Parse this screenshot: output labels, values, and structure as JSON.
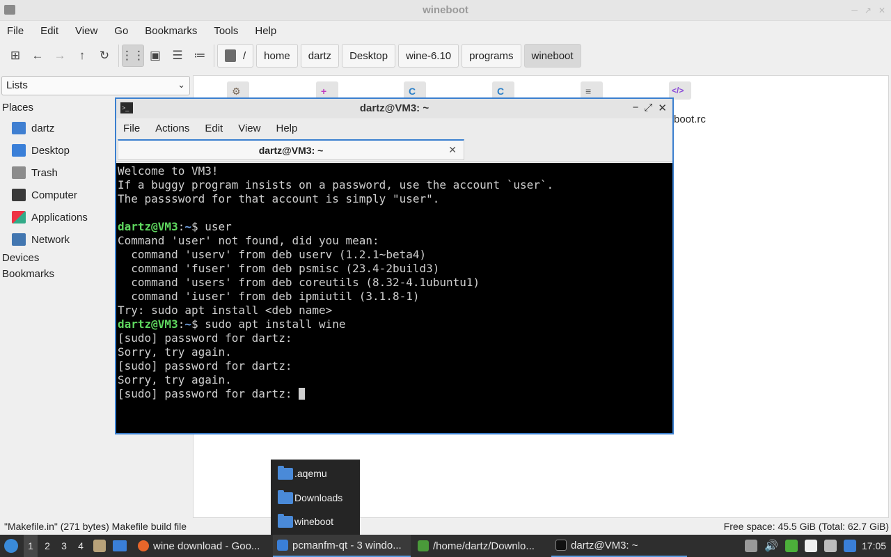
{
  "fm": {
    "title": "wineboot",
    "menu": [
      "File",
      "Edit",
      "View",
      "Go",
      "Bookmarks",
      "Tools",
      "Help"
    ],
    "toolbar_icons": [
      "new-tab-icon",
      "back-icon",
      "forward-icon",
      "up-icon",
      "reload-icon",
      "icon-view-icon",
      "thumbnail-view-icon",
      "compact-view-icon",
      "detailed-list-icon"
    ],
    "breadcrumb": [
      "/",
      "home",
      "dartz",
      "Desktop",
      "wine-6.10",
      "programs",
      "wineboot"
    ],
    "sidebar": {
      "mode": "Lists",
      "places_label": "Places",
      "places": [
        "dartz",
        "Desktop",
        "Trash",
        "Computer",
        "Applications",
        "Network"
      ],
      "devices_label": "Devices",
      "bookmarks_label": "Bookmarks"
    },
    "visible_file_label": "boot.rc",
    "status_left": "\"Makefile.in\" (271 bytes) Makefile build file",
    "status_right": "Free space: 45.5 GiB (Total: 62.7 GiB)"
  },
  "terminal": {
    "title": "dartz@VM3: ~",
    "menu": [
      "File",
      "Actions",
      "Edit",
      "View",
      "Help"
    ],
    "tab_label": "dartz@VM3: ~",
    "prompt_user": "dartz@VM3",
    "prompt_path": "~",
    "lines_1": "Welcome to VM3!\nIf a buggy program insists on a password, use the account `user`.\nThe passsword for that account is simply \"user\".\n",
    "cmd1": "$ user",
    "lines_2": "Command 'user' not found, did you mean:\n  command 'userv' from deb userv (1.2.1~beta4)\n  command 'fuser' from deb psmisc (23.4-2build3)\n  command 'users' from deb coreutils (8.32-4.1ubuntu1)\n  command 'iuser' from deb ipmiutil (3.1.8-1)\nTry: sudo apt install <deb name>",
    "cmd2": "$ sudo apt install wine",
    "lines_3": "[sudo] password for dartz:\nSorry, try again.\n[sudo] password for dartz:\nSorry, try again.",
    "last_line": "[sudo] password for dartz: "
  },
  "popup": {
    "items": [
      ".aqemu",
      "Downloads",
      "wineboot"
    ]
  },
  "taskbar": {
    "desktops": [
      "1",
      "2",
      "3",
      "4"
    ],
    "tasks": [
      "wine download - Goo...",
      "pcmanfm-qt - 3 windo...",
      "/home/dartz/Downlo...",
      "dartz@VM3: ~"
    ],
    "clock": "17:05"
  }
}
